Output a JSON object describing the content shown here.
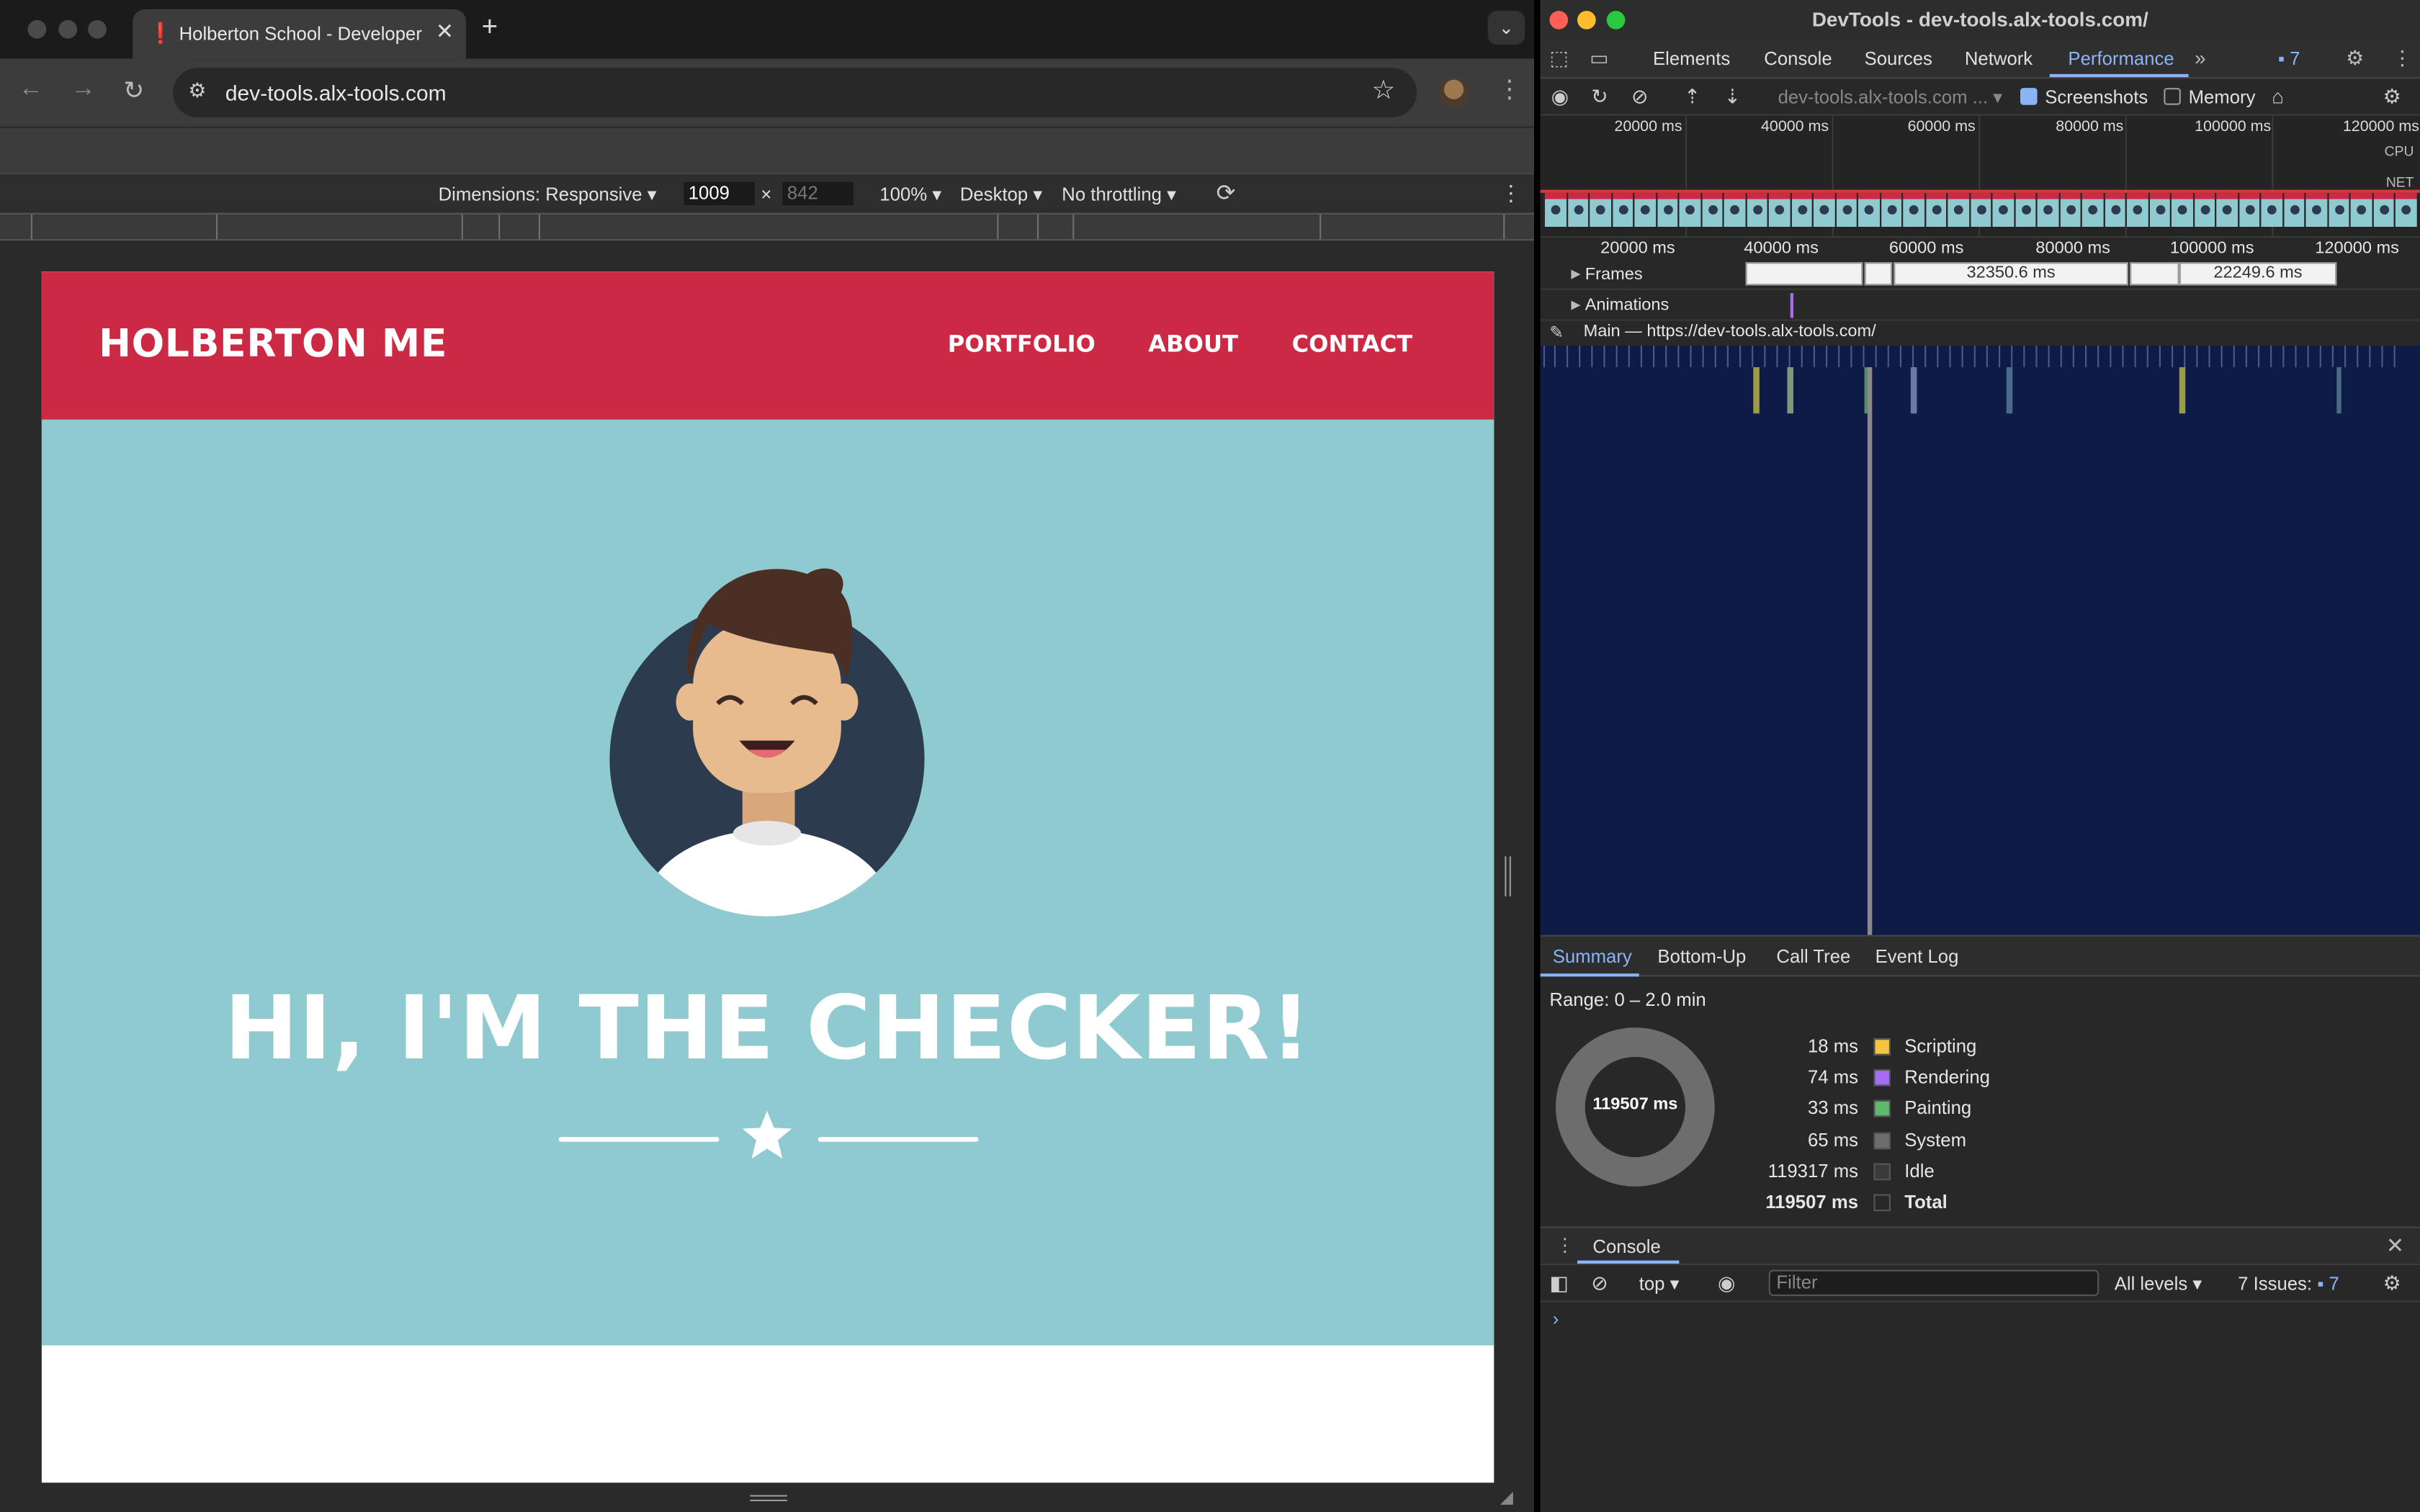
{
  "browser": {
    "tab_title": "Holberton School - Developer",
    "url": "dev-tools.alx-tools.com",
    "device_toolbar": {
      "dimensions_label": "Dimensions: Responsive",
      "width": "1009",
      "height": "842",
      "zoom": "100%",
      "device_type": "Desktop",
      "throttling": "No throttling"
    }
  },
  "site": {
    "logo": "HOLBERTON ME",
    "nav": [
      "PORTFOLIO",
      "ABOUT",
      "CONTACT"
    ],
    "hero_title": "HI, I'M THE CHECKER!",
    "colors": {
      "header": "#cc2a44",
      "hero": "#8ecacf"
    }
  },
  "devtools": {
    "window_title": "DevTools - dev-tools.alx-tools.com/",
    "tabs": [
      "Elements",
      "Console",
      "Sources",
      "Network",
      "Performance"
    ],
    "active_tab": "Performance",
    "issues_badge": "7",
    "profile_select": "dev-tools.alx-tools.com ...",
    "screenshots_label": "Screenshots",
    "screenshots_checked": true,
    "memory_label": "Memory",
    "memory_checked": false,
    "overview_ticks": [
      "20000 ms",
      "40000 ms",
      "60000 ms",
      "80000 ms",
      "100000 ms",
      "120000 ms"
    ],
    "overview_side_labels": {
      "cpu": "CPU",
      "net": "NET"
    },
    "timeline_ticks": [
      "20000 ms",
      "40000 ms",
      "60000 ms",
      "80000 ms",
      "100000 ms",
      "120000 ms"
    ],
    "tracks": {
      "frames_label": "Frames",
      "frame_values": [
        "32350.6 ms",
        "22249.6 ms"
      ],
      "animations_label": "Animations",
      "main_label": "Main — https://dev-tools.alx-tools.com/"
    },
    "bottom_tabs": [
      "Summary",
      "Bottom-Up",
      "Call Tree",
      "Event Log"
    ],
    "summary": {
      "range": "Range: 0 – 2.0 min",
      "donut_value": "119507 ms",
      "rows": [
        {
          "value": "18 ms",
          "name": "Scripting",
          "color": "#f5c542"
        },
        {
          "value": "74 ms",
          "name": "Rendering",
          "color": "#a56cf5"
        },
        {
          "value": "33 ms",
          "name": "Painting",
          "color": "#5fb86d"
        },
        {
          "value": "65 ms",
          "name": "System",
          "color": "#6d6d6d"
        },
        {
          "value": "119317 ms",
          "name": "Idle",
          "color": "#3a3a3a"
        },
        {
          "value": "119507 ms",
          "name": "Total",
          "color": "#282828"
        }
      ]
    },
    "console": {
      "title": "Console",
      "context": "top",
      "filter_placeholder": "Filter",
      "levels": "All levels",
      "issues_text": "7 Issues:",
      "issues_count": "7"
    }
  }
}
